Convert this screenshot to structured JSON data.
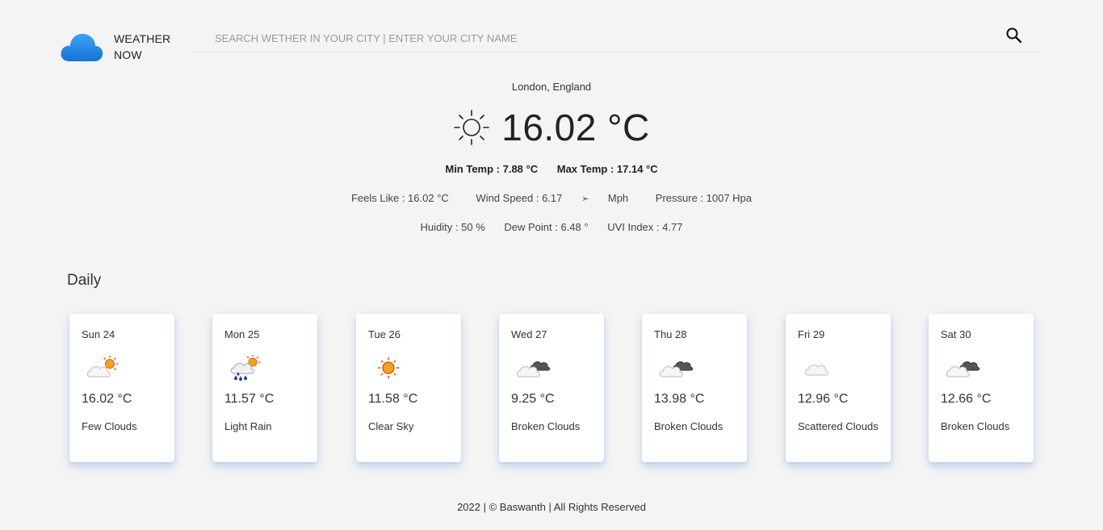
{
  "brand": {
    "line1": "WEATHER",
    "line2": "NOW",
    "icon": "cloud-icon"
  },
  "search": {
    "placeholder": "SEARCH WETHER IN YOUR CITY | ENTER YOUR CITY NAME",
    "value": "",
    "icon": "search-icon"
  },
  "current": {
    "location": "London, England",
    "icon": "sun-icon",
    "temperature": "16.02 °C",
    "min_temp": "Min Temp : 7.88 °C",
    "max_temp": "Max Temp : 17.14 °C",
    "feels_like": "Feels Like : 16.02 °C",
    "wind_speed_label": "Wind Speed : 6.17",
    "wind_unit": "Mph",
    "wind_icon": "wind-direction-arrow-icon",
    "pressure": "Pressure : 1007 Hpa",
    "humidity": "Huidity : 50 %",
    "dew_point": "Dew Point : 6.48 °",
    "uvi": "UVI Index : 4.77"
  },
  "daily": {
    "title": "Daily",
    "days": [
      {
        "day": "Sun 24",
        "temp": "16.02 °C",
        "desc": "Few Clouds",
        "icon": "few-clouds-icon"
      },
      {
        "day": "Mon 25",
        "temp": "11.57 °C",
        "desc": "Light Rain",
        "icon": "light-rain-icon"
      },
      {
        "day": "Tue 26",
        "temp": "11.58 °C",
        "desc": "Clear Sky",
        "icon": "clear-sky-icon"
      },
      {
        "day": "Wed 27",
        "temp": "9.25 °C",
        "desc": "Broken Clouds",
        "icon": "broken-clouds-icon"
      },
      {
        "day": "Thu 28",
        "temp": "13.98 °C",
        "desc": "Broken Clouds",
        "icon": "broken-clouds-icon"
      },
      {
        "day": "Fri 29",
        "temp": "12.96 °C",
        "desc": "Scattered Clouds",
        "icon": "scattered-clouds-icon"
      },
      {
        "day": "Sat 30",
        "temp": "12.66 °C",
        "desc": "Broken Clouds",
        "icon": "broken-clouds-icon"
      }
    ]
  },
  "footer": {
    "text": "2022 | © Baswanth | All Rights Reserved"
  }
}
